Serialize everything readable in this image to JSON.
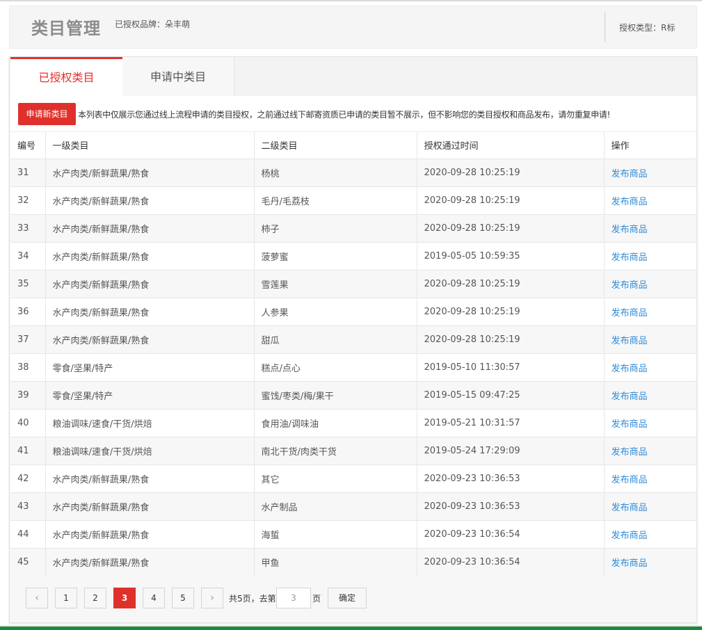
{
  "header": {
    "title": "类目管理",
    "brand": "已授权品牌：朵丰萌",
    "auth_type": "授权类型：R标"
  },
  "tabs": [
    {
      "label": "已授权类目",
      "active": true
    },
    {
      "label": "申请中类目",
      "active": false
    }
  ],
  "notice": {
    "apply_button": "申请新类目",
    "text": "本列表中仅展示您通过线上流程申请的类目授权，之前通过线下邮寄资质已申请的类目暂不展示，但不影响您的类目授权和商品发布，请勿重复申请!"
  },
  "table": {
    "columns": [
      "编号",
      "一级类目",
      "二级类目",
      "授权通过时间",
      "操作"
    ],
    "rows": [
      {
        "id": "31",
        "cat1": "水产肉类/新鲜蔬果/熟食",
        "cat2": "杨桃",
        "time": "2020-09-28 10:25:19",
        "action": "发布商品"
      },
      {
        "id": "32",
        "cat1": "水产肉类/新鲜蔬果/熟食",
        "cat2": "毛丹/毛荔枝",
        "time": "2020-09-28 10:25:19",
        "action": "发布商品"
      },
      {
        "id": "33",
        "cat1": "水产肉类/新鲜蔬果/熟食",
        "cat2": "柿子",
        "time": "2020-09-28 10:25:19",
        "action": "发布商品"
      },
      {
        "id": "34",
        "cat1": "水产肉类/新鲜蔬果/熟食",
        "cat2": "菠萝蜜",
        "time": "2019-05-05 10:59:35",
        "action": "发布商品"
      },
      {
        "id": "35",
        "cat1": "水产肉类/新鲜蔬果/熟食",
        "cat2": "雪莲果",
        "time": "2020-09-28 10:25:19",
        "action": "发布商品"
      },
      {
        "id": "36",
        "cat1": "水产肉类/新鲜蔬果/熟食",
        "cat2": "人参果",
        "time": "2020-09-28 10:25:19",
        "action": "发布商品"
      },
      {
        "id": "37",
        "cat1": "水产肉类/新鲜蔬果/熟食",
        "cat2": "甜瓜",
        "time": "2020-09-28 10:25:19",
        "action": "发布商品"
      },
      {
        "id": "38",
        "cat1": "零食/坚果/特产",
        "cat2": "糕点/点心",
        "time": "2019-05-10 11:30:57",
        "action": "发布商品"
      },
      {
        "id": "39",
        "cat1": "零食/坚果/特产",
        "cat2": "蜜饯/枣类/梅/果干",
        "time": "2019-05-15 09:47:25",
        "action": "发布商品"
      },
      {
        "id": "40",
        "cat1": "粮油调味/速食/干货/烘焙",
        "cat2": "食用油/调味油",
        "time": "2019-05-21 10:31:57",
        "action": "发布商品"
      },
      {
        "id": "41",
        "cat1": "粮油调味/速食/干货/烘焙",
        "cat2": "南北干货/肉类干货",
        "time": "2019-05-24 17:29:09",
        "action": "发布商品"
      },
      {
        "id": "42",
        "cat1": "水产肉类/新鲜蔬果/熟食",
        "cat2": "其它",
        "time": "2020-09-23 10:36:53",
        "action": "发布商品"
      },
      {
        "id": "43",
        "cat1": "水产肉类/新鲜蔬果/熟食",
        "cat2": "水产制品",
        "time": "2020-09-23 10:36:53",
        "action": "发布商品"
      },
      {
        "id": "44",
        "cat1": "水产肉类/新鲜蔬果/熟食",
        "cat2": "海蜇",
        "time": "2020-09-23 10:36:54",
        "action": "发布商品"
      },
      {
        "id": "45",
        "cat1": "水产肉类/新鲜蔬果/熟食",
        "cat2": "甲鱼",
        "time": "2020-09-23 10:36:54",
        "action": "发布商品"
      }
    ]
  },
  "pagination": {
    "prev_icon": "chevron-left-icon",
    "next_icon": "chevron-right-icon",
    "pages": [
      "1",
      "2",
      "3",
      "4",
      "5"
    ],
    "current": "3",
    "total_text": "共5页，去第",
    "page_suffix": "页",
    "input_value": "3",
    "confirm_label": "确定"
  },
  "colors": {
    "accent": "#e0302c",
    "link": "#2c8bd9"
  }
}
